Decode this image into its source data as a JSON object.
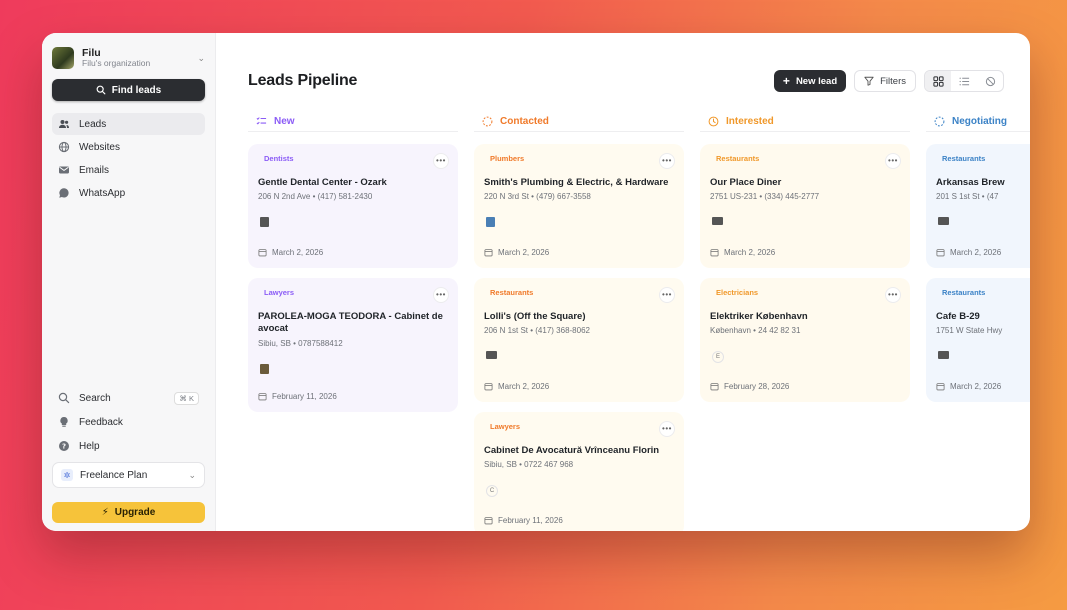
{
  "sidebar": {
    "org_name": "Filu",
    "org_sub": "Filu's organization",
    "find_leads": "Find leads",
    "nav": [
      {
        "label": "Leads",
        "icon": "users-icon",
        "active": true
      },
      {
        "label": "Websites",
        "icon": "globe-icon"
      },
      {
        "label": "Emails",
        "icon": "mail-icon"
      },
      {
        "label": "WhatsApp",
        "icon": "chat-icon"
      }
    ],
    "search_label": "Search",
    "search_shortcut": "⌘ K",
    "feedback_label": "Feedback",
    "help_label": "Help",
    "plan_label": "Freelance Plan",
    "upgrade_label": "Upgrade"
  },
  "header": {
    "title": "Leads Pipeline",
    "new_lead": "New lead",
    "filters": "Filters"
  },
  "columns": [
    {
      "title": "New",
      "color": "#8b5cf6",
      "cards": [
        {
          "tag": "Dentists",
          "title": "Gentle Dental Center - Ozark",
          "sub": "206 N 2nd Ave • (417) 581-2430",
          "date": "March 2, 2026"
        },
        {
          "tag": "Lawyers",
          "title": "PAROLEA-MOGA TEODORA - Cabinet de avocat",
          "sub": "Sibiu, SB • 0787588412",
          "date": "February 11, 2026"
        }
      ]
    },
    {
      "title": "Contacted",
      "color": "#f07a2a",
      "cards": [
        {
          "tag": "Plumbers",
          "title": "Smith's Plumbing & Electric, & Hardware",
          "sub": "220 N 3rd St • (479) 667-3558",
          "date": "March 2, 2026"
        },
        {
          "tag": "Restaurants",
          "title": "Lolli's (Off the Square)",
          "sub": "206 N 1st St • (417) 368-8062",
          "date": "March 2, 2026"
        },
        {
          "tag": "Lawyers",
          "title": "Cabinet De Avocatură Vrînceanu Florin",
          "sub": "Sibiu, SB • 0722 467 968",
          "date": "February 11, 2026",
          "thumb": "C"
        }
      ]
    },
    {
      "title": "Interested",
      "color": "#f0982a",
      "cards": [
        {
          "tag": "Restaurants",
          "title": "Our Place Diner",
          "sub": "2751 US-231 • (334) 445-2777",
          "date": "March 2, 2026"
        },
        {
          "tag": "Electricians",
          "title": "Elektriker København",
          "sub": "København • 24 42 82 31",
          "date": "February 28, 2026",
          "thumb": "E"
        }
      ]
    },
    {
      "title": "Negotiating",
      "color": "#3b82c6",
      "cards": [
        {
          "tag": "Restaurants",
          "title": "Arkansas Brew",
          "sub": "201 S 1st St • (47",
          "date": "March 2, 2026"
        },
        {
          "tag": "Restaurants",
          "title": "Cafe B-29",
          "sub": "1751 W State Hwy",
          "date": "March 2, 2026"
        }
      ]
    }
  ]
}
